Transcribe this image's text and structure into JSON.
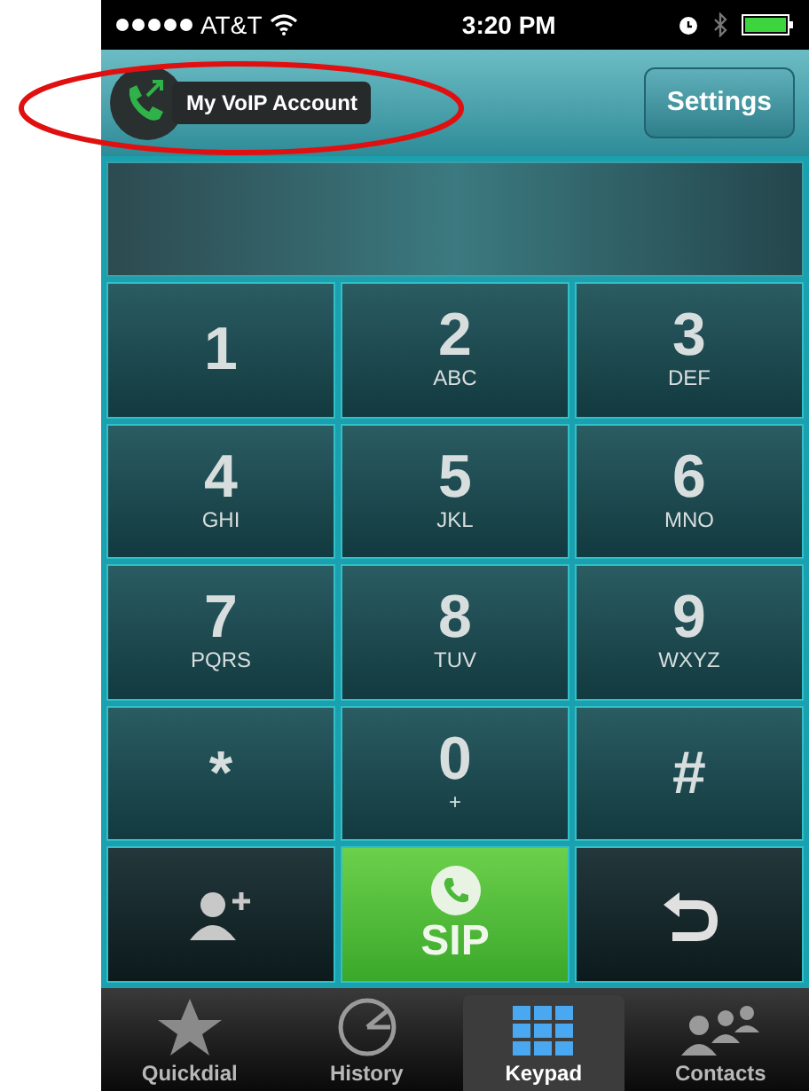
{
  "status_bar": {
    "carrier": "AT&T",
    "time": "3:20 PM"
  },
  "header": {
    "account": "My VoIP Account",
    "settings": "Settings"
  },
  "keypad": [
    {
      "digit": "1"
    },
    {
      "digit": "2",
      "letters": "ABC"
    },
    {
      "digit": "3",
      "letters": "DEF"
    },
    {
      "digit": "4",
      "letters": "GHI"
    },
    {
      "digit": "5",
      "letters": "JKL"
    },
    {
      "digit": "6",
      "letters": "MNO"
    },
    {
      "digit": "7",
      "letters": "PQRS"
    },
    {
      "digit": "8",
      "letters": "TUV"
    },
    {
      "digit": "9",
      "letters": "WXYZ"
    },
    {
      "digit": "*"
    },
    {
      "digit": "0",
      "letters": "+"
    },
    {
      "digit": "#"
    }
  ],
  "actions": [
    {
      "kind": "add-contact"
    },
    {
      "kind": "call",
      "label": "SIP"
    },
    {
      "kind": "undo"
    }
  ],
  "tabs": [
    {
      "label": "Quickdial",
      "kind": "star",
      "selected": false
    },
    {
      "label": "History",
      "kind": "clock",
      "selected": false
    },
    {
      "label": "Keypad",
      "kind": "grid",
      "selected": true
    },
    {
      "label": "Contacts",
      "kind": "people",
      "selected": false
    }
  ]
}
